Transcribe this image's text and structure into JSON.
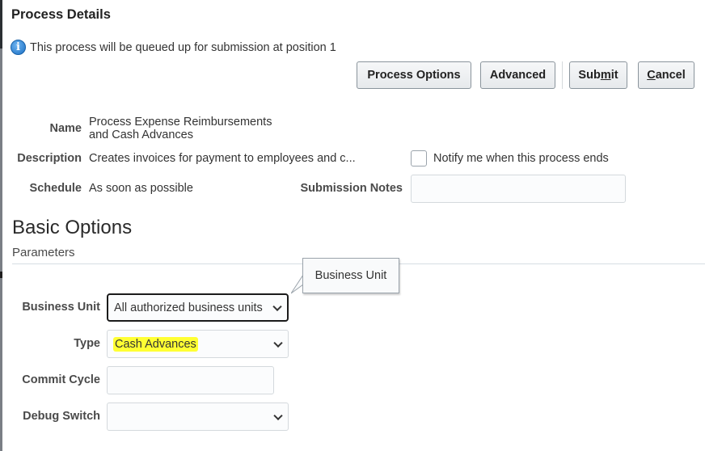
{
  "dialog": {
    "title": "Process Details",
    "info_message": "This process will be queued up for submission at position 1"
  },
  "toolbar": {
    "process_options_label": "Process Options",
    "advanced_label": "Advanced",
    "submit_label_pre": "Sub",
    "submit_label_accel": "m",
    "submit_label_post": "it",
    "cancel_label_accel": "C",
    "cancel_label_post": "ancel"
  },
  "details": {
    "name_label": "Name",
    "name_line1": "Process Expense Reimbursements",
    "name_line2": "and Cash Advances",
    "description_label": "Description",
    "description_value": "Creates invoices for payment to employees and c...",
    "schedule_label": "Schedule",
    "schedule_value": "As soon as possible",
    "notify_label": "Notify me when this process ends",
    "notify_checked": false,
    "submission_notes_label": "Submission Notes",
    "submission_notes_value": ""
  },
  "basic_options": {
    "title": "Basic Options",
    "subtitle": "Parameters",
    "business_unit_label": "Business Unit",
    "business_unit_value": "All authorized business units",
    "type_label": "Type",
    "type_value": "Cash Advances",
    "type_highlight_color": "#ffff33",
    "commit_cycle_label": "Commit Cycle",
    "commit_cycle_value": "",
    "debug_switch_label": "Debug Switch",
    "debug_switch_value": ""
  },
  "tooltip": {
    "text": "Business Unit"
  },
  "icons": {
    "info": "info-circle-icon",
    "chevron": "chevron-down-icon"
  }
}
